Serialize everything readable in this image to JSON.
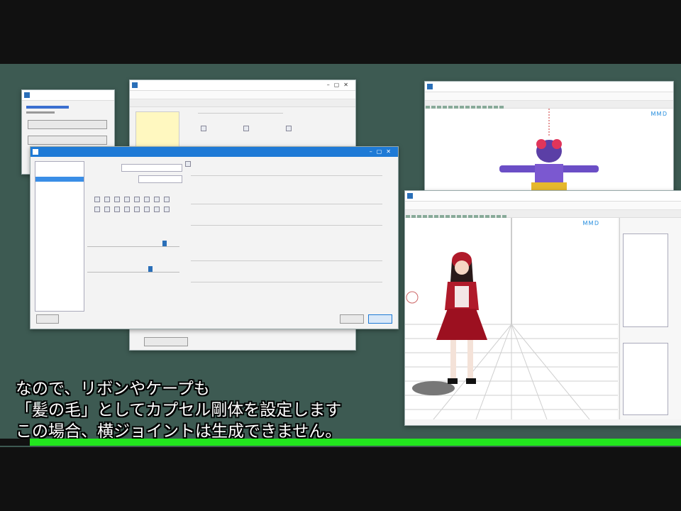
{
  "subtitles": {
    "line1": "なので、リボンやケープも",
    "line2": "「髪の毛」としてカプセル剛体を設定します",
    "line3": "この場合、横ジョイントは生成できません。"
  },
  "progress": {
    "fraction": 1.0,
    "color": "#22e61e"
  },
  "watermark": "ＭＭＤ",
  "colors": {
    "desktop": "#3d5a52",
    "accent": "#1e7ad6"
  }
}
